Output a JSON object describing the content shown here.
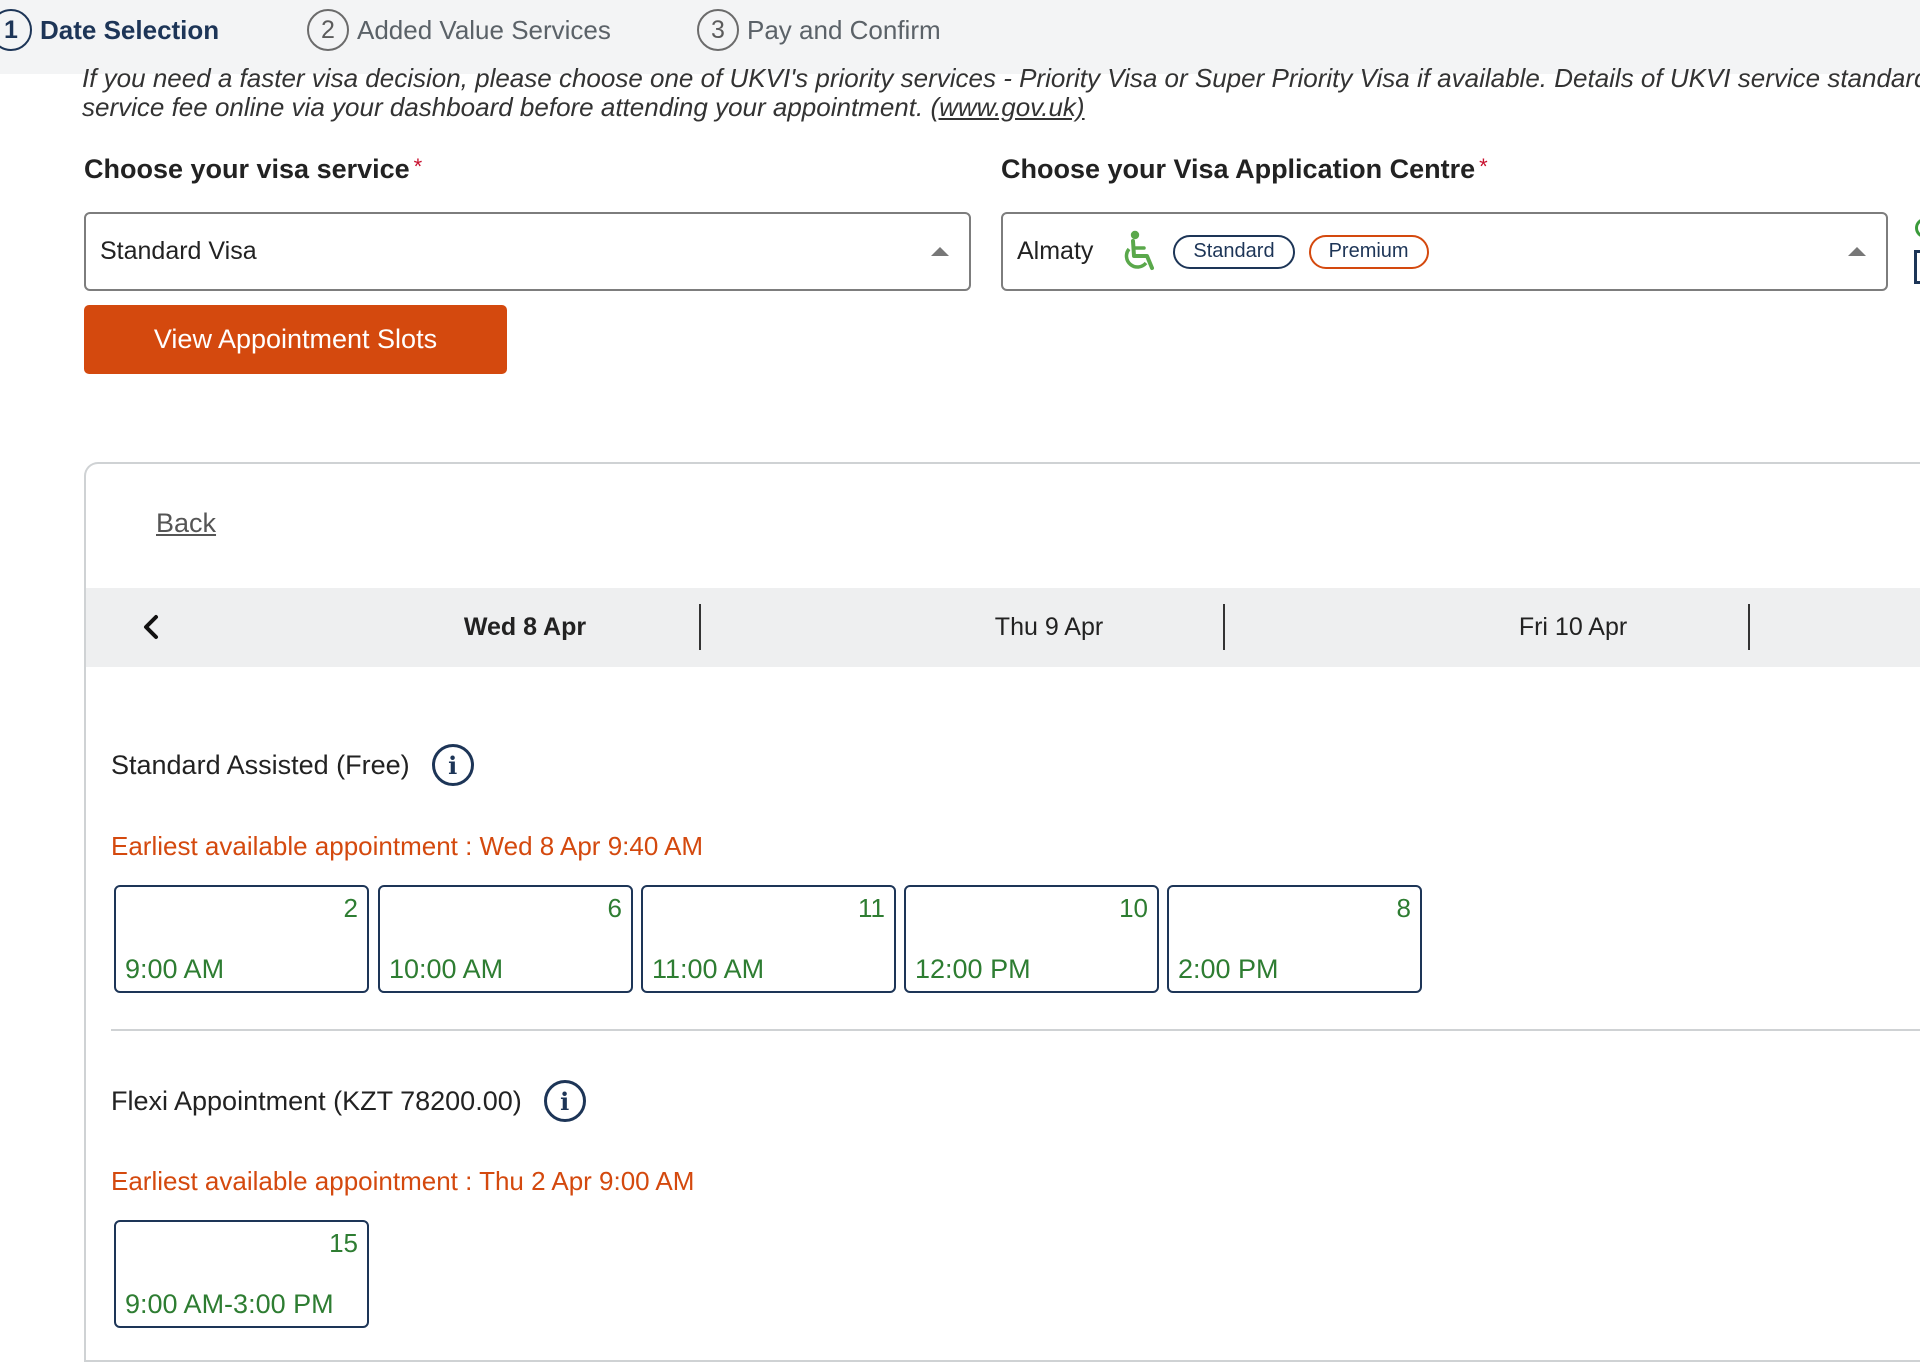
{
  "stepper": {
    "steps": [
      {
        "num": "1",
        "label": "Date Selection"
      },
      {
        "num": "2",
        "label": "Added Value Services"
      },
      {
        "num": "3",
        "label": "Pay and Confirm"
      }
    ]
  },
  "intro": {
    "line1": "If you need a faster visa decision, please choose one of UKVI's priority services - Priority Visa or Super Priority Visa if available. Details of UKVI service standards",
    "line2": "service fee online via your dashboard before attending your appointment.",
    "link": "(www.gov.uk)"
  },
  "form": {
    "service_label": "Choose your visa service",
    "service_value": "Standard Visa",
    "centre_label": "Choose your Visa Application Centre",
    "centre_value": "Almaty",
    "required_mark": "*",
    "badge_standard": "Standard",
    "badge_premium": "Premium",
    "view_button": "View Appointment Slots"
  },
  "calendar": {
    "back": "Back",
    "dates": [
      "Wed 8 Apr",
      "Thu 9 Apr",
      "Fri 10 Apr"
    ],
    "selected_date": "Wed 8 Apr"
  },
  "sections": [
    {
      "title": "Standard Assisted (Free)",
      "earliest": "Earliest available appointment : Wed 8 Apr 9:40 AM",
      "slots": [
        {
          "count": "2",
          "time": "9:00 AM"
        },
        {
          "count": "6",
          "time": "10:00 AM"
        },
        {
          "count": "11",
          "time": "11:00 AM"
        },
        {
          "count": "10",
          "time": "12:00 PM"
        },
        {
          "count": "8",
          "time": "2:00 PM"
        }
      ]
    },
    {
      "title": "Flexi Appointment (KZT 78200.00)",
      "earliest": "Earliest available appointment : Thu 2 Apr 9:00 AM",
      "slots": [
        {
          "count": "15",
          "time": "9:00 AM-3:00 PM"
        }
      ]
    }
  ],
  "colors": {
    "brand_navy": "#1d3557",
    "accent_orange": "#d4490e",
    "slot_green": "#2e7d32",
    "accessible_green": "#5aa84b"
  },
  "icons": {
    "prev": "chevron-left-icon",
    "info": "info-icon",
    "accessibility": "wheelchair-icon",
    "dropdown": "caret-up-icon"
  }
}
